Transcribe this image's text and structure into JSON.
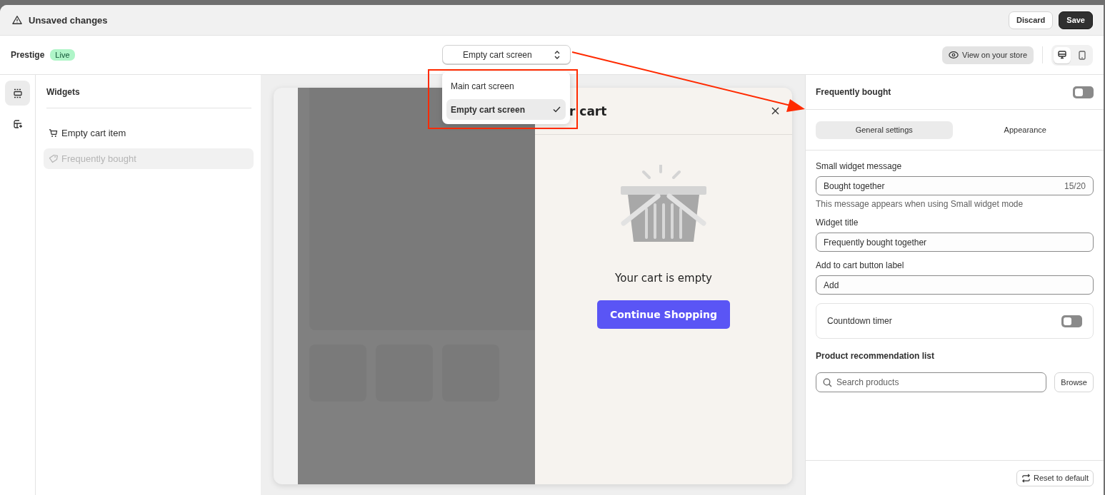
{
  "topbar": {
    "title": "Unsaved changes",
    "buttons": [
      {
        "label": "Discard",
        "kind": "secondary"
      },
      {
        "label": "Save",
        "kind": "primary"
      }
    ]
  },
  "header": {
    "store": "Prestige",
    "badge": "Live",
    "screen_select": {
      "value": "Empty cart screen",
      "options": [
        {
          "label": "Main cart screen",
          "selected": false
        },
        {
          "label": "Empty cart screen",
          "selected": true
        }
      ]
    },
    "view_button": "View on your store",
    "devices": [
      {
        "kind": "desktop",
        "selected": true
      },
      {
        "kind": "mobile",
        "selected": false
      }
    ]
  },
  "rail": [
    {
      "kind": "sections",
      "selected": true
    },
    {
      "kind": "apps",
      "selected": false
    }
  ],
  "widgets": {
    "title": "Widgets",
    "items": [
      {
        "label": "Empty cart item",
        "kind": "cart",
        "selected": false,
        "disabled": false
      },
      {
        "label": "Frequently bought",
        "kind": "tag",
        "selected": true,
        "disabled": true
      }
    ]
  },
  "preview": {
    "cart_title": "r cart",
    "message": "Your cart is empty",
    "button": "Continue Shopping"
  },
  "settings": {
    "title": "Frequently bought",
    "on": false,
    "tabs": [
      {
        "label": "General settings",
        "selected": true
      },
      {
        "label": "Appearance",
        "selected": false
      }
    ],
    "fields": [
      {
        "label": "Small widget message",
        "value": "Bought together",
        "counter": "15/20",
        "help": "This message appears when using Small widget mode"
      },
      {
        "label": "Widget title",
        "value": "Frequently bought together"
      },
      {
        "label": "Add to cart button label",
        "value": "Add"
      }
    ],
    "countdown": {
      "label": "Countdown timer",
      "on": false
    },
    "recommendations": {
      "title": "Product recommendation list",
      "placeholder": "Search products",
      "button": "Browse"
    },
    "reset": "Reset to default"
  },
  "annotation": {
    "highlight_box": true,
    "arrow": true
  }
}
